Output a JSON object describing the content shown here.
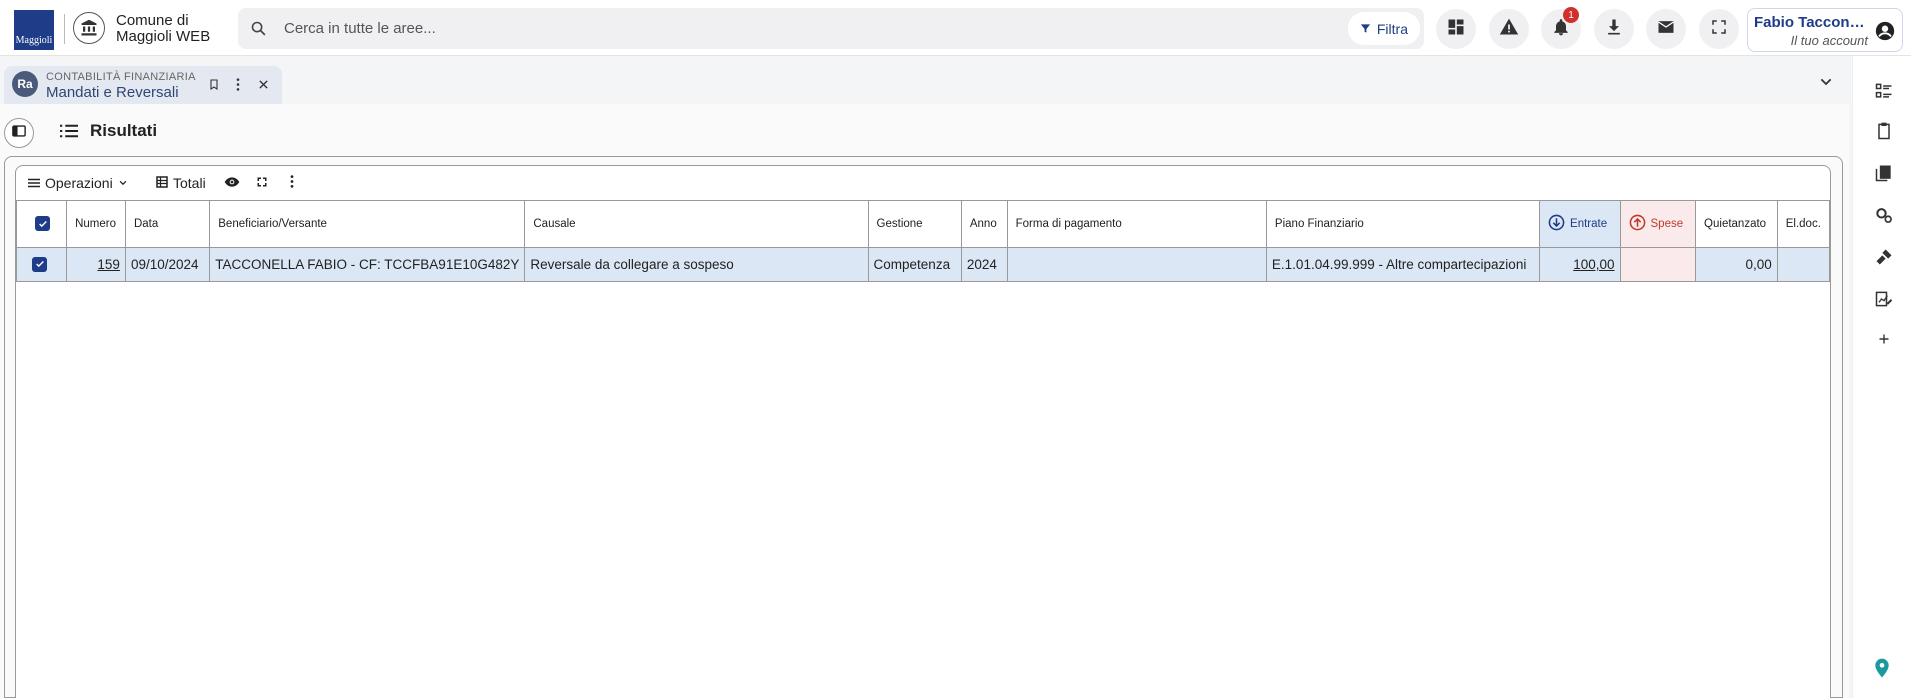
{
  "header": {
    "logo_text": "Maggioli",
    "app_title": "Comune di Maggioli WEB",
    "search_placeholder": "Cerca in tutte le aree...",
    "filter_label": "Filtra",
    "notifications_count": "1",
    "account_name": "Fabio Tacconell...",
    "account_sub": "Il tuo account"
  },
  "tab": {
    "icon_text": "Ra",
    "category": "CONTABILITÀ FINANZIARIA",
    "title": "Mandati e Reversali"
  },
  "results": {
    "title": "Risultati"
  },
  "toolbar": {
    "operations_label": "Operazioni",
    "totals_label": "Totali"
  },
  "table": {
    "headers": {
      "numero": "Numero",
      "data": "Data",
      "beneficiario": "Beneficiario/Versante",
      "causale": "Causale",
      "gestione": "Gestione",
      "anno": "Anno",
      "forma": "Forma di pagamento",
      "piano": "Piano Finanziario",
      "entrate": "Entrate",
      "spese": "Spese",
      "quietanzato": "Quietanzato",
      "eldoc": "El.doc."
    },
    "rows": [
      {
        "numero": "159",
        "data": "09/10/2024",
        "beneficiario": "TACCONELLA FABIO - CF: TCCFBA91E10G482Y",
        "causale": "Reversale da collegare a sospeso",
        "gestione": "Competenza",
        "anno": "2024",
        "forma": "",
        "piano": "E.1.01.04.99.999 - Altre compartecipazioni",
        "entrate": "100,00",
        "spese": "",
        "quietanzato": "0,00",
        "eldoc": ""
      }
    ]
  },
  "colors": {
    "brand": "#1f3c88",
    "entrate_bg": "#dbe7f5",
    "spese_bg": "#fbeaec",
    "spese_accent": "#c0392b",
    "badge": "#d32f2f"
  }
}
